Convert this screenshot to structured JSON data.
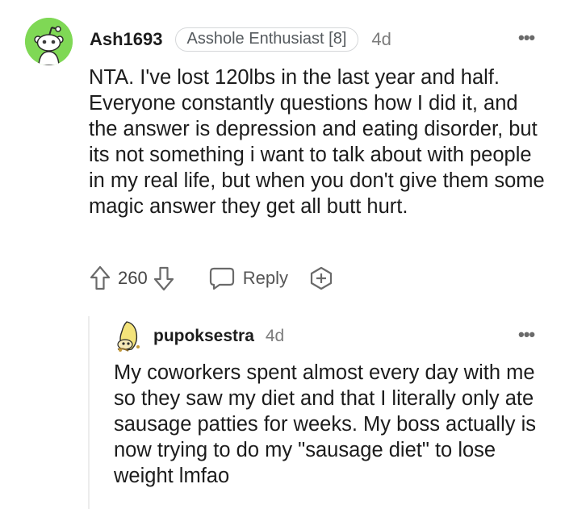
{
  "comment": {
    "username": "Ash1693",
    "flair": "Asshole Enthusiast [8]",
    "age": "4d",
    "more_label": "•••",
    "body": "NTA. I've lost 120lbs in the last year and half. Everyone constantly questions how I did it, and the answer is depression and eating disorder, but its not something i want to talk about with people in my real life, but when you don't give them some magic answer they get all butt hurt.",
    "score": "260",
    "reply_label": "Reply",
    "avatar_color": "#7fd855"
  },
  "reply": {
    "username": "pupoksestra",
    "age": "4d",
    "more_label": "•••",
    "body": "My coworkers spent almost every day with me so they saw my diet and that I literally only ate sausage patties for weeks. My boss actually is now trying to do my \"sausage diet\" to lose weight lmfao"
  },
  "icons": {
    "upvote": "upvote-arrow-icon",
    "downvote": "downvote-arrow-icon",
    "reply": "speech-bubble-icon",
    "award": "award-plus-icon",
    "more": "more-dots-icon"
  }
}
